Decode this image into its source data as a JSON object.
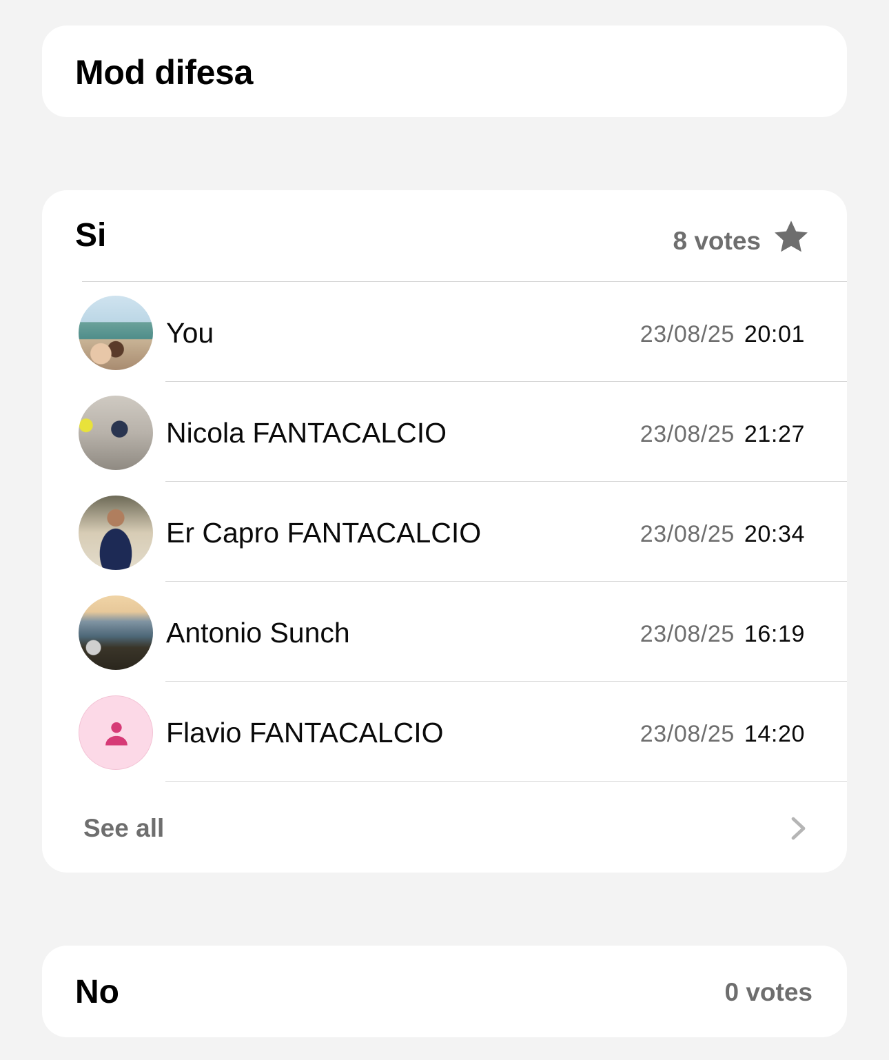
{
  "question": {
    "title": "Mod difesa"
  },
  "options": [
    {
      "label": "Si",
      "votes_label": "8 votes",
      "votes": 8,
      "starred": true,
      "voters": [
        {
          "name": "You",
          "date": "23/08/25",
          "time": "20:01",
          "avatar": "photo"
        },
        {
          "name": "Nicola FANTACALCIO",
          "date": "23/08/25",
          "time": "21:27",
          "avatar": "photo"
        },
        {
          "name": "Er Capro FANTACALCIO",
          "date": "23/08/25",
          "time": "20:34",
          "avatar": "photo"
        },
        {
          "name": "Antonio Sunch",
          "date": "23/08/25",
          "time": "16:19",
          "avatar": "photo"
        },
        {
          "name": "Flavio FANTACALCIO",
          "date": "23/08/25",
          "time": "14:20",
          "avatar": "person-icon"
        }
      ],
      "see_all_label": "See all"
    },
    {
      "label": "No",
      "votes_label": "0 votes",
      "votes": 0
    }
  ],
  "colors": {
    "background": "#f3f3f3",
    "card": "#ffffff",
    "secondary_text": "#6e6e6e",
    "default_avatar_bg": "#fcd9e7",
    "default_avatar_icon": "#d63a76"
  }
}
